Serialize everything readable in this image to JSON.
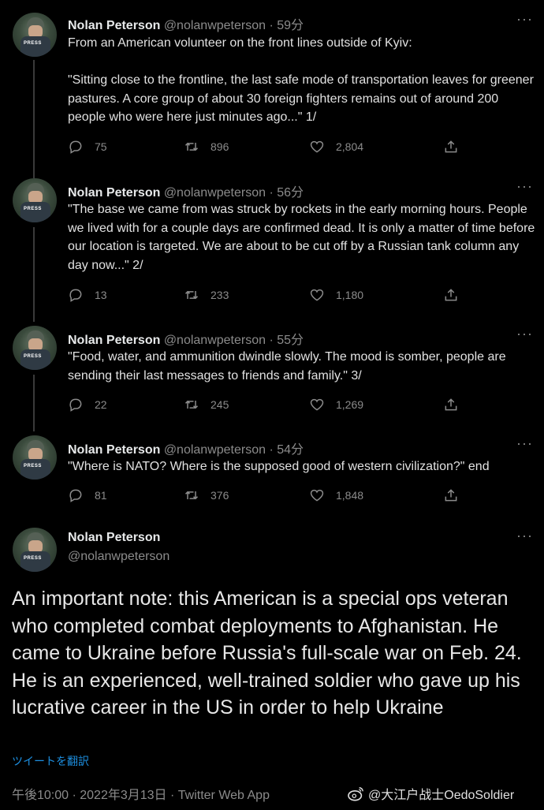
{
  "tweets": [
    {
      "name": "Nolan Peterson",
      "handle": "@nolanwpeterson",
      "time": "· 59分",
      "text": "From an American volunteer on the front lines outside of Kyiv:\n\n\"Sitting close to the frontline, the last safe mode of transportation leaves for greener pastures. A core group of about 30 foreign fighters remains out of around 200 people who were here just minutes ago...\" 1/",
      "replies": "75",
      "retweets": "896",
      "likes": "2,804"
    },
    {
      "name": "Nolan Peterson",
      "handle": "@nolanwpeterson",
      "time": "· 56分",
      "text": "\"The base we came from was struck by rockets in the early morning hours. People we lived with for a couple days are confirmed dead. It is only a matter of time before our location is targeted. We are about to be cut off by a Russian tank column any day now...\" 2/",
      "replies": "13",
      "retweets": "233",
      "likes": "1,180"
    },
    {
      "name": "Nolan Peterson",
      "handle": "@nolanwpeterson",
      "time": "· 55分",
      "text": "\"Food, water, and ammunition dwindle slowly. The mood is somber, people are sending their last messages to friends and family.\" 3/",
      "replies": "22",
      "retweets": "245",
      "likes": "1,269"
    },
    {
      "name": "Nolan Peterson",
      "handle": "@nolanwpeterson",
      "time": "· 54分",
      "text": "\"Where is NATO? Where is the supposed good of western civilization?\" end",
      "replies": "81",
      "retweets": "376",
      "likes": "1,848"
    }
  ],
  "main_tweet": {
    "name": "Nolan Peterson",
    "handle": "@nolanwpeterson",
    "text": "An important note: this American is a special ops veteran who completed combat deployments to Afghanistan. He came to Ukraine before Russia's full-scale war on Feb. 24. He is an experienced, well-trained soldier who gave up his lucrative career in the US in order to help Ukraine",
    "translate_label": "ツイートを翻訳",
    "meta": "午後10:00 · 2022年3月13日 · Twitter Web App"
  },
  "avatar_badge": "PRESS",
  "more_glyph": "···",
  "watermark": "@大江户战士OedoSoldier",
  "colors": {
    "background": "#000000",
    "link": "#1d8fe0",
    "muted": "#8b8b8b",
    "text": "#e1e1e1"
  },
  "icons": [
    "reply-icon",
    "retweet-icon",
    "like-icon",
    "share-icon",
    "more-icon",
    "weibo-icon"
  ]
}
